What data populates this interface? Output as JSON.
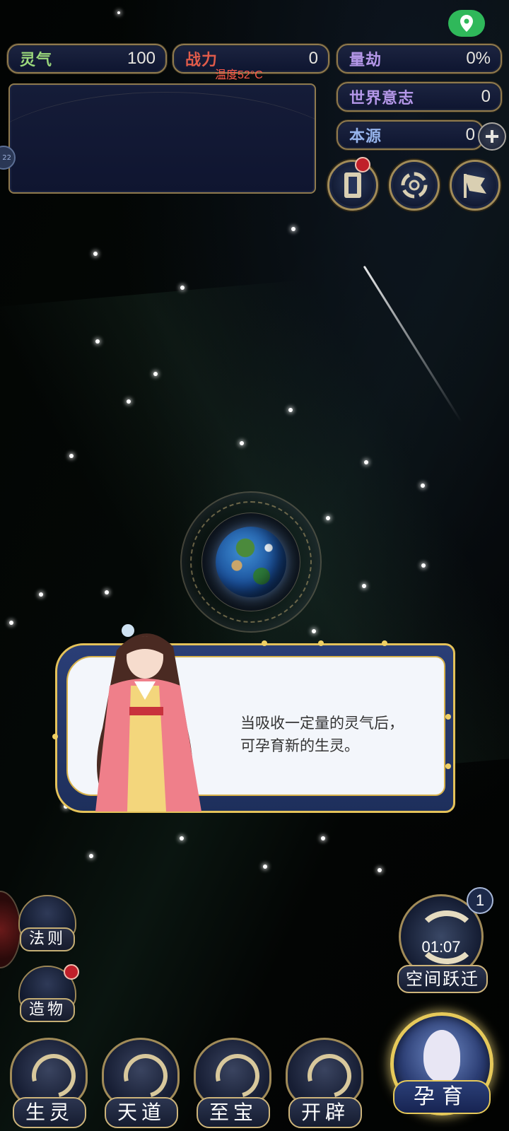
{
  "status": {
    "location_icon": "location-pin-icon",
    "temperature": "温度52°C"
  },
  "stats": {
    "lingqi": {
      "label": "灵气",
      "value": "100"
    },
    "zhanli": {
      "label": "战力",
      "value": "0"
    },
    "liangjie": {
      "label": "量劫",
      "value": "0%"
    },
    "world_will": {
      "label": "世界意志",
      "value": "0"
    },
    "origin": {
      "label": "本源",
      "value": "0"
    }
  },
  "side_tab_text": "22",
  "dialog": {
    "line1": "当吸收一定量的灵气后，",
    "line2": "可孕育新的生灵。"
  },
  "left_buttons": [
    {
      "label": "法则"
    },
    {
      "label": "造物"
    }
  ],
  "space_jump": {
    "badge": "1",
    "timer": "01:07",
    "label": "空间跃迁"
  },
  "nav": [
    {
      "label": "生灵"
    },
    {
      "label": "天道"
    },
    {
      "label": "至宝"
    },
    {
      "label": "开辟"
    }
  ],
  "breed": {
    "label": "孕育"
  },
  "colors": {
    "gold_border": "#8f7a4e",
    "panel_bg": "#0f1530",
    "lingqi_label": "#9bd87c",
    "zhanli_label": "#e05b4a",
    "liangjie_label": "#b497e8",
    "world_label": "#b497e8",
    "origin_label": "#96b4ec",
    "temperature": "#ff5a4a",
    "badge_red": "#c0202a",
    "location_green": "#2fb85a"
  }
}
